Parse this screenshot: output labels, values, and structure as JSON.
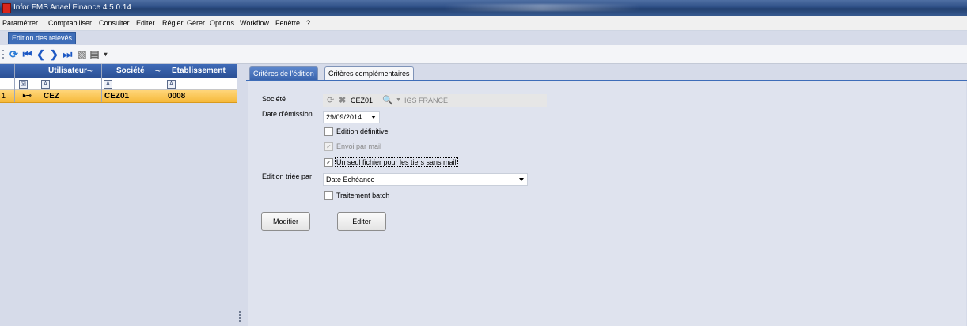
{
  "window": {
    "title": "Infor FMS Anael Finance 4.5.0.14"
  },
  "menu": [
    "Paramétrer",
    "Comptabiliser",
    "Consulter",
    "Editer",
    "Régler",
    "Gérer",
    "Options",
    "Workflow",
    "Fenêtre",
    "?"
  ],
  "doc_tab": "Edition des relevés",
  "grid": {
    "columns": [
      "Utilisateur",
      "Société",
      "Etablissement"
    ],
    "row_number": "1",
    "row": [
      "CEZ",
      "CEZ01",
      "0008"
    ]
  },
  "tabs": {
    "active": "Critères de l'édition",
    "other": "Critères complémentaires"
  },
  "form": {
    "societe_label": "Société",
    "societe_code": "CEZ01",
    "societe_name": "IGS FRANCE",
    "date_label": "Date d'émission",
    "date_value": "29/09/2014",
    "chk_definitive": {
      "label": "Edition définitive",
      "checked": false
    },
    "chk_mail": {
      "label": "Envoi par mail",
      "checked": true,
      "disabled": true
    },
    "chk_seul": {
      "label": "Un seul fichier pour les tiers sans mail",
      "checked": true
    },
    "tri_label": "Edition triée par",
    "tri_value": "Date Echéance",
    "chk_batch": {
      "label": "Traitement batch",
      "checked": false
    },
    "btn_modifier": "Modifier",
    "btn_editer": "Editer"
  },
  "colors": {
    "accent": "#3e6db8",
    "selected_row": "#f6b93b",
    "background": "#d6dbe9"
  }
}
